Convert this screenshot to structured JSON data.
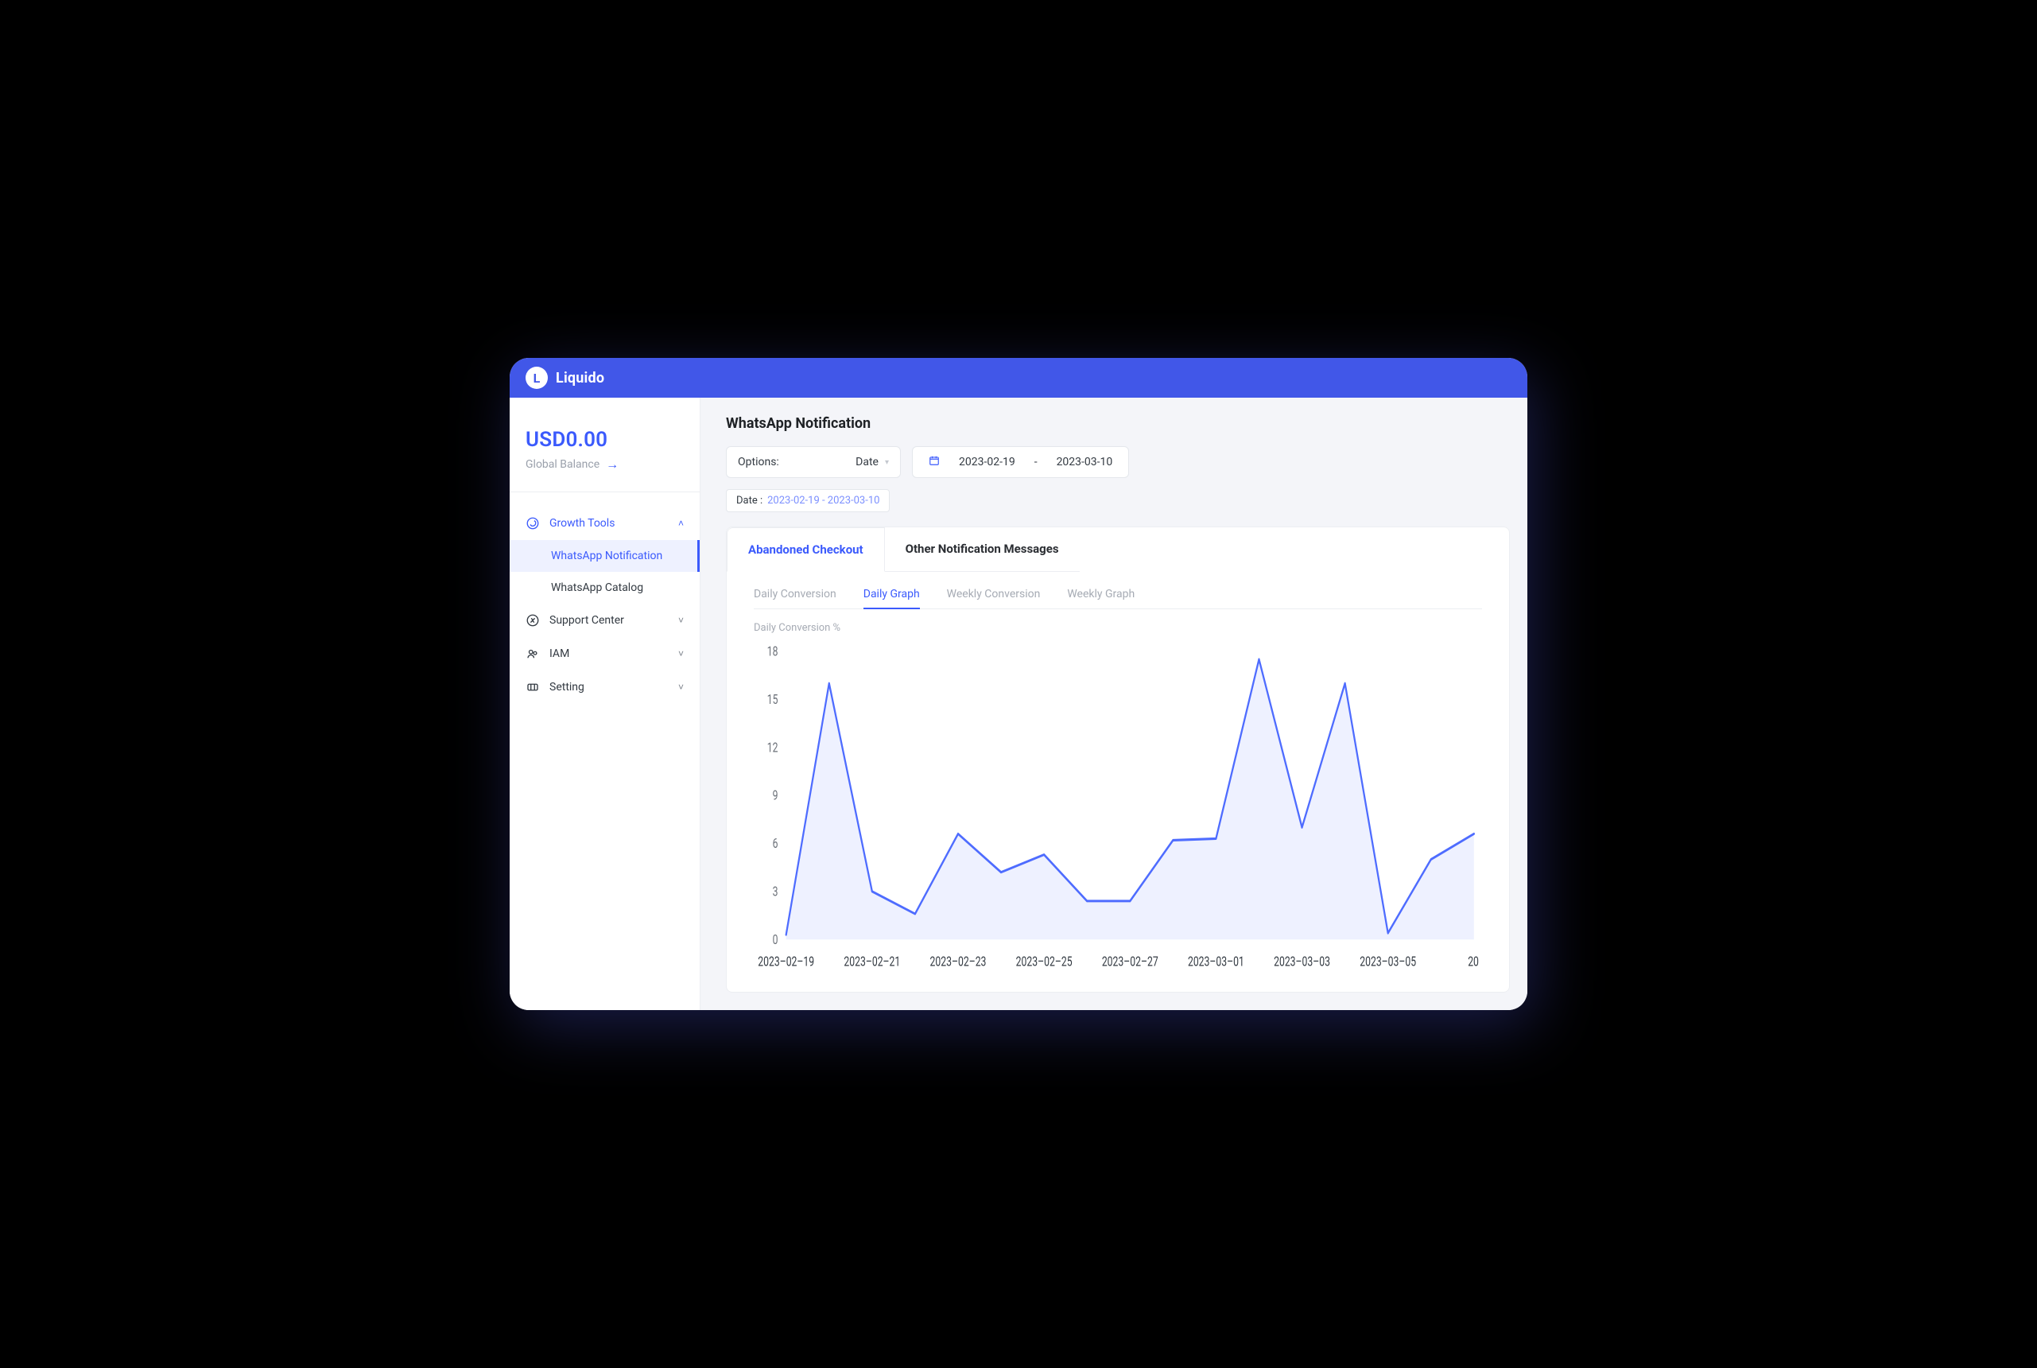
{
  "brand": "Liquido",
  "brand_letter": "L",
  "sidebar": {
    "balance_amount": "USD0.00",
    "balance_label": "Global Balance",
    "groups": [
      {
        "label": "Growth Tools",
        "icon": "whatsapp",
        "expanded": true,
        "active": true,
        "items": [
          {
            "label": "WhatsApp Notification",
            "active": true
          },
          {
            "label": "WhatsApp Catalog",
            "active": false
          }
        ]
      },
      {
        "label": "Support Center",
        "icon": "support",
        "expanded": false
      },
      {
        "label": "IAM",
        "icon": "users",
        "expanded": false
      },
      {
        "label": "Setting",
        "icon": "ticket",
        "expanded": false
      }
    ]
  },
  "page": {
    "title": "WhatsApp Notification",
    "options_label": "Options:",
    "options_value": "Date",
    "date_from": "2023-02-19",
    "date_to": "2023-03-10",
    "date_sep": "-",
    "tag_label": "Date :",
    "tag_value": "2023-02-19 - 2023-03-10",
    "tabs": [
      {
        "label": "Abandoned Checkout",
        "active": true
      },
      {
        "label": "Other Notification Messages",
        "active": false
      }
    ],
    "sub_tabs": [
      {
        "label": "Daily Conversion",
        "active": false
      },
      {
        "label": "Daily Graph",
        "active": true
      },
      {
        "label": "Weekly Conversion",
        "active": false
      },
      {
        "label": "Weekly Graph",
        "active": false
      }
    ],
    "chart_label": "Daily Conversion %"
  },
  "chart_data": {
    "type": "area",
    "title": "Daily Conversion %",
    "xlabel": "",
    "ylabel": "",
    "ylim": [
      0,
      18
    ],
    "y_ticks": [
      0,
      3,
      6,
      9,
      12,
      15,
      18
    ],
    "x_tick_labels": [
      "2023-02-19",
      "2023-02-21",
      "2023-02-23",
      "2023-02-25",
      "2023-02-27",
      "2023-03-01",
      "2023-03-03",
      "2023-03-05"
    ],
    "x": [
      "2023-02-19",
      "2023-02-20",
      "2023-02-21",
      "2023-02-22",
      "2023-02-23",
      "2023-02-24",
      "2023-02-25",
      "2023-02-26",
      "2023-02-27",
      "2023-02-28",
      "2023-03-01",
      "2023-03-02",
      "2023-03-03",
      "2023-03-04",
      "2023-03-05",
      "2023-03-06",
      "2023-03-07"
    ],
    "values": [
      0.3,
      16.0,
      3.0,
      1.6,
      6.6,
      4.2,
      5.3,
      2.4,
      2.4,
      6.2,
      6.3,
      17.5,
      7.0,
      16.0,
      0.4,
      5.0,
      6.6
    ]
  }
}
